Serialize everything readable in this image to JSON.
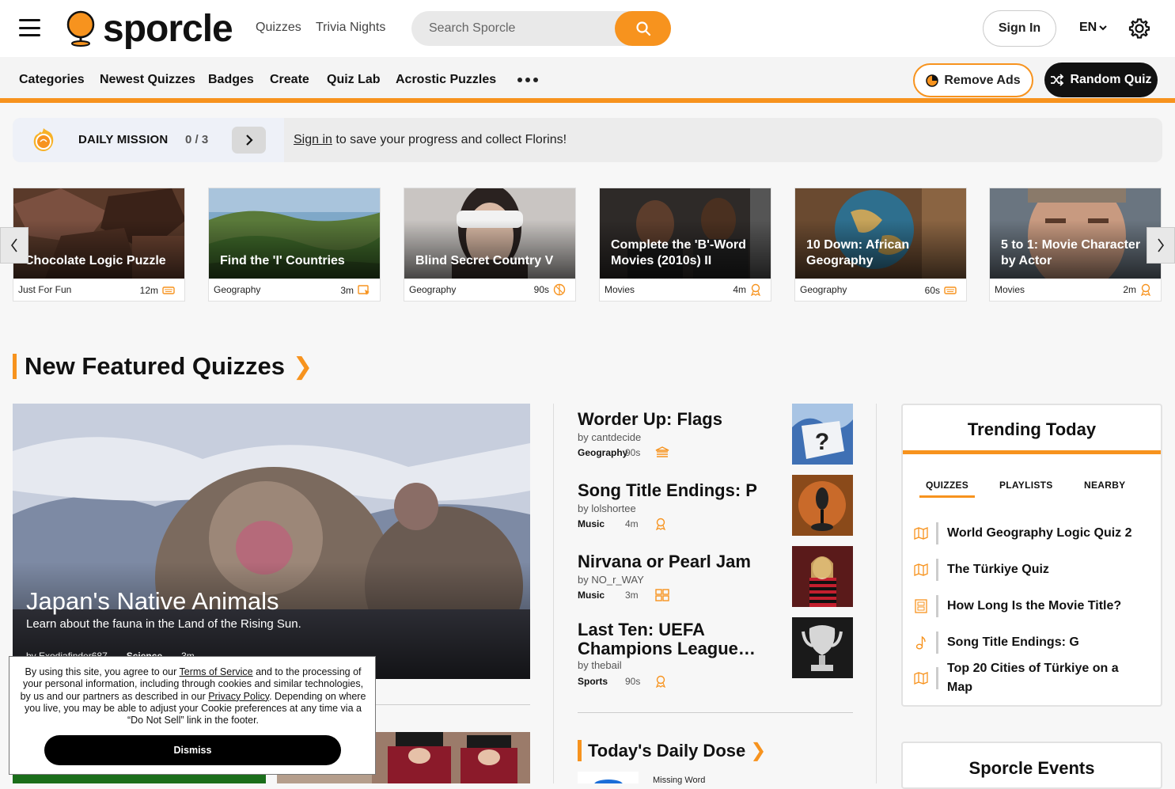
{
  "header": {
    "logo_text": "sporcle",
    "links": [
      "Quizzes",
      "Trivia Nights"
    ],
    "search_placeholder": "Search Sporcle",
    "sign_in": "Sign In",
    "language": "EN"
  },
  "nav": {
    "items": [
      "Categories",
      "Newest Quizzes",
      "Badges",
      "Create",
      "Quiz Lab",
      "Acrostic Puzzles"
    ],
    "remove_ads": "Remove Ads",
    "random_quiz": "Random Quiz"
  },
  "mission": {
    "title": "DAILY MISSION",
    "count": "0 / 3",
    "sign_in_link": "Sign in",
    "message": " to save your progress and collect Florins!"
  },
  "carousel": [
    {
      "title": "Chocolate Logic Puzzle",
      "category": "Just For Fun",
      "time": "12m",
      "icon": "keyboard-icon"
    },
    {
      "title": "Find the 'I' Countries",
      "category": "Geography",
      "time": "3m",
      "icon": "map-click-icon"
    },
    {
      "title": "Blind Secret Country V",
      "category": "Geography",
      "time": "90s",
      "icon": "no-entry-icon"
    },
    {
      "title": "Complete the 'B'-Word Movies (2010s) II",
      "category": "Movies",
      "time": "4m",
      "icon": "badge-icon"
    },
    {
      "title": "10 Down: African Geography",
      "category": "Geography",
      "time": "60s",
      "icon": "keyboard-icon"
    },
    {
      "title": "5 to 1: Movie Character by Actor",
      "category": "Movies",
      "time": "2m",
      "icon": "badge-icon"
    }
  ],
  "featured": {
    "heading": "New Featured Quizzes",
    "hero": {
      "title": "Japan's Native Animals",
      "subtitle": "Learn about the fauna in the Land of the Rising Sun.",
      "author": "by Exodiafinder687",
      "category": "Science",
      "time": "3m"
    },
    "list": [
      {
        "title": "Worder Up: Flags",
        "author": "by cantdecide",
        "category": "Geography",
        "time": "90s"
      },
      {
        "title": "Song Title Endings: P",
        "author": "by lolshortee",
        "category": "Music",
        "time": "4m"
      },
      {
        "title": "Nirvana or Pearl Jam",
        "author": "by NO_r_WAY",
        "category": "Music",
        "time": "3m"
      },
      {
        "title": "Last Ten: UEFA Champions League…",
        "author": "by thebail",
        "category": "Sports",
        "time": "90s"
      }
    ],
    "daily_dose_heading": "Today's Daily Dose",
    "daily_dose_label": "Missing Word"
  },
  "trending": {
    "title": "Trending Today",
    "tabs": [
      "QUIZZES",
      "PLAYLISTS",
      "NEARBY"
    ],
    "items": [
      {
        "title": "World Geography Logic Quiz 2",
        "icon": "map-icon"
      },
      {
        "title": "The Türkiye Quiz",
        "icon": "map-icon"
      },
      {
        "title": "How Long Is the Movie Title?",
        "icon": "film-icon"
      },
      {
        "title": "Song Title Endings: G",
        "icon": "music-note-icon"
      },
      {
        "title": "Top 20 Cities of Türkiye on a Map",
        "icon": "map-icon"
      }
    ]
  },
  "events": {
    "title": "Sporcle Events"
  },
  "cookie": {
    "text1": "By using this site, you agree to our ",
    "tos": "Terms of Service",
    "text2": " and to the processing of your personal information, including through cookies and similar technologies, by us and our partners as described in our ",
    "privacy": "Privacy Policy",
    "text3": ". Depending on where you live, you may be able to adjust your Cookie preferences at any time via a “Do Not Sell” link in the footer.",
    "dismiss": "Dismiss"
  },
  "colors": {
    "accent": "#f7931e",
    "dark": "#111111"
  }
}
